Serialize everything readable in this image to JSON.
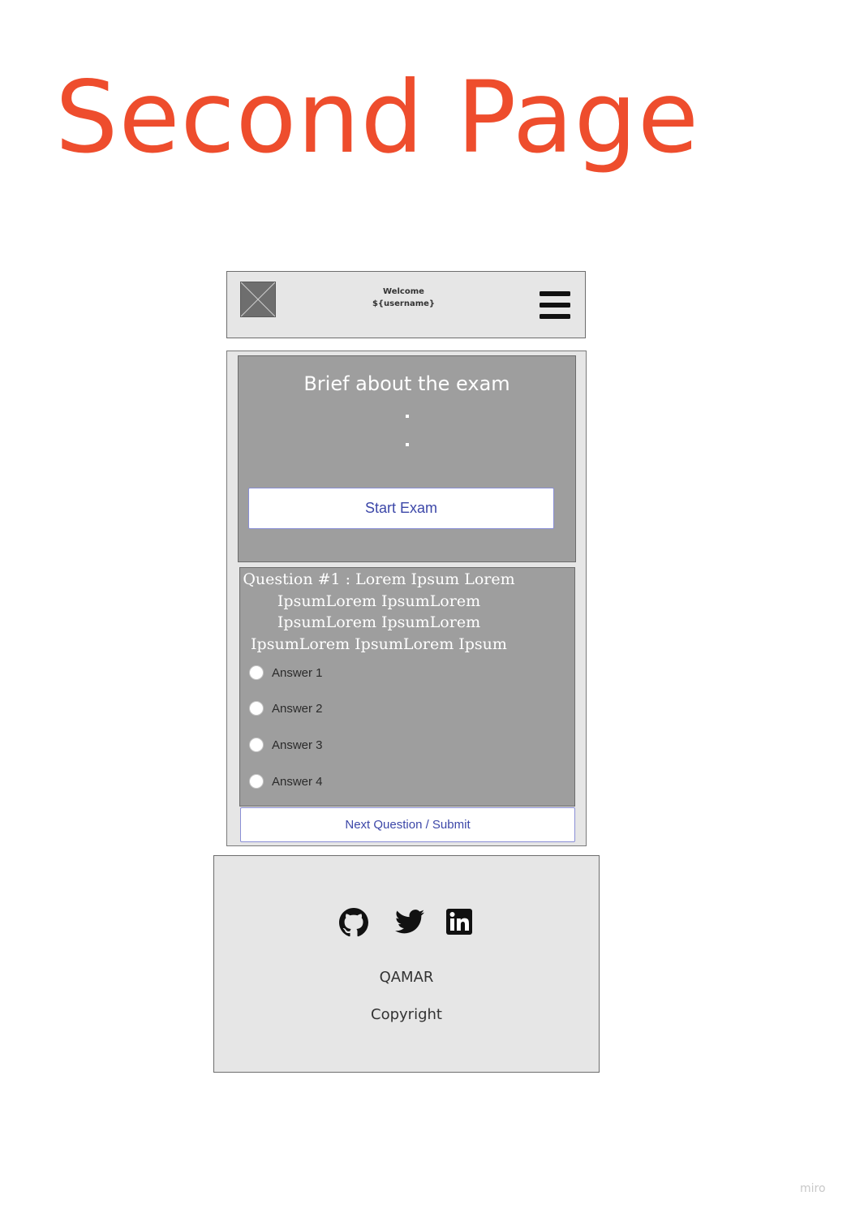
{
  "page_title": "Second Page",
  "header": {
    "welcome_line1": "Welcome",
    "welcome_line2": "${username}",
    "logo_icon": "image-placeholder-icon",
    "menu_icon": "hamburger-menu-icon"
  },
  "brief": {
    "title": "Brief about the exam",
    "start_button_label": "Start Exam"
  },
  "question": {
    "lines": [
      "Question #1 : Lorem Ipsum Lorem",
      "IpsumLorem IpsumLorem",
      "IpsumLorem IpsumLorem",
      "IpsumLorem IpsumLorem Ipsum"
    ],
    "answers": [
      "Answer 1",
      "Answer 2",
      "Answer 3",
      "Answer 4"
    ],
    "next_button_label": "Next Question / Submit"
  },
  "footer": {
    "social_icons": [
      "github-icon",
      "twitter-icon",
      "linkedin-icon"
    ],
    "brand": "QAMAR",
    "copyright": "Copyright"
  },
  "watermark": "miro",
  "colors": {
    "title_accent": "#ee4d2d",
    "panel_gray": "#9e9e9e",
    "frame_gray": "#e6e6e6",
    "button_text": "#3c47a8"
  }
}
